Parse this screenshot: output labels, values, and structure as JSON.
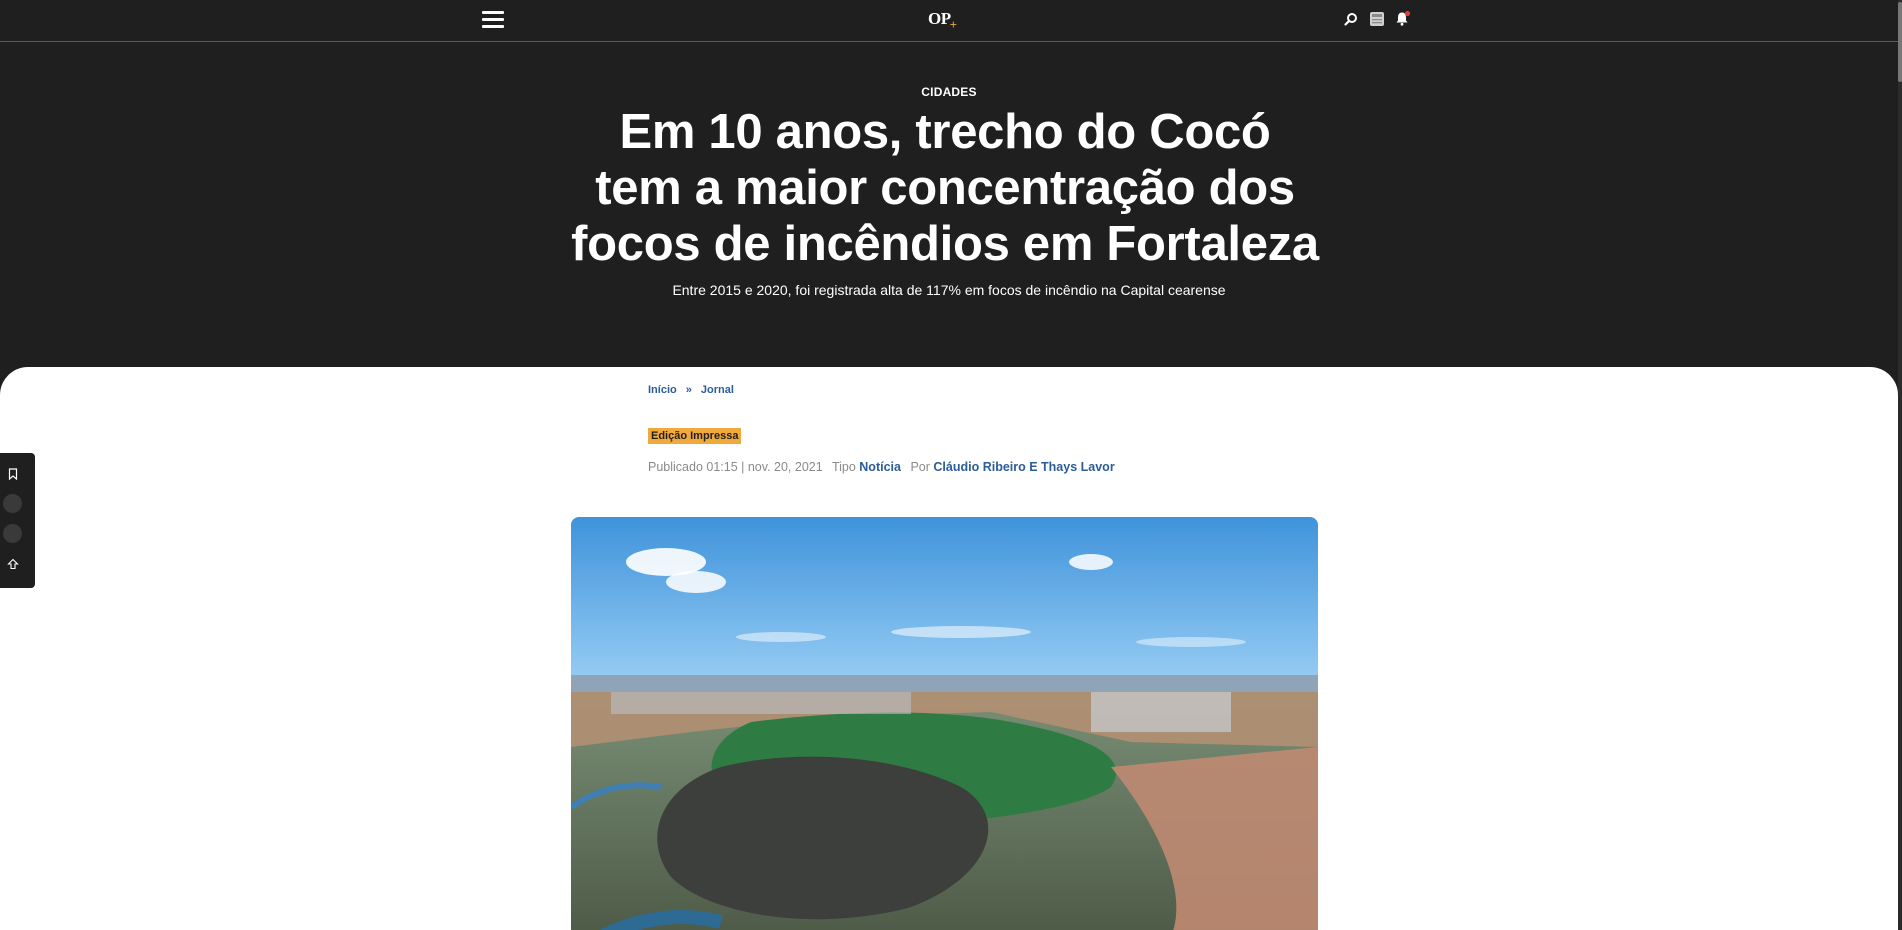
{
  "nav": {
    "logo_text": "OP",
    "logo_plus": "+",
    "icons": [
      "menu-icon",
      "search-icon",
      "newspaper-icon",
      "bell-icon"
    ]
  },
  "hero": {
    "kicker": "CIDADES",
    "headline": "Em 10 anos, trecho do Cocó tem a maior concentração dos focos de incêndios em Fortaleza",
    "subtitle": "Entre 2015 e 2020, foi registrada alta de 117% em focos de incêndio na Capital cearense"
  },
  "breadcrumb": {
    "items": [
      "Início",
      "Jornal"
    ],
    "separator": "»"
  },
  "article": {
    "tag": "Edição Impressa",
    "published_label": "Publicado 01:15 | nov. 20, 2021",
    "type_label": "Tipo",
    "type_value": "Notícia",
    "by_label": "Por",
    "authors": "Cláudio Ribeiro E Thays Lavor"
  },
  "side_toolbar": {
    "icons": [
      "bookmark-icon",
      "share-icon",
      "comment-icon",
      "scroll-top-icon"
    ]
  },
  "colors": {
    "background_dark": "#1f1f1f",
    "link_blue": "#2b5d99",
    "accent_orange": "#f2a93b",
    "notification_red": "#e53935"
  }
}
